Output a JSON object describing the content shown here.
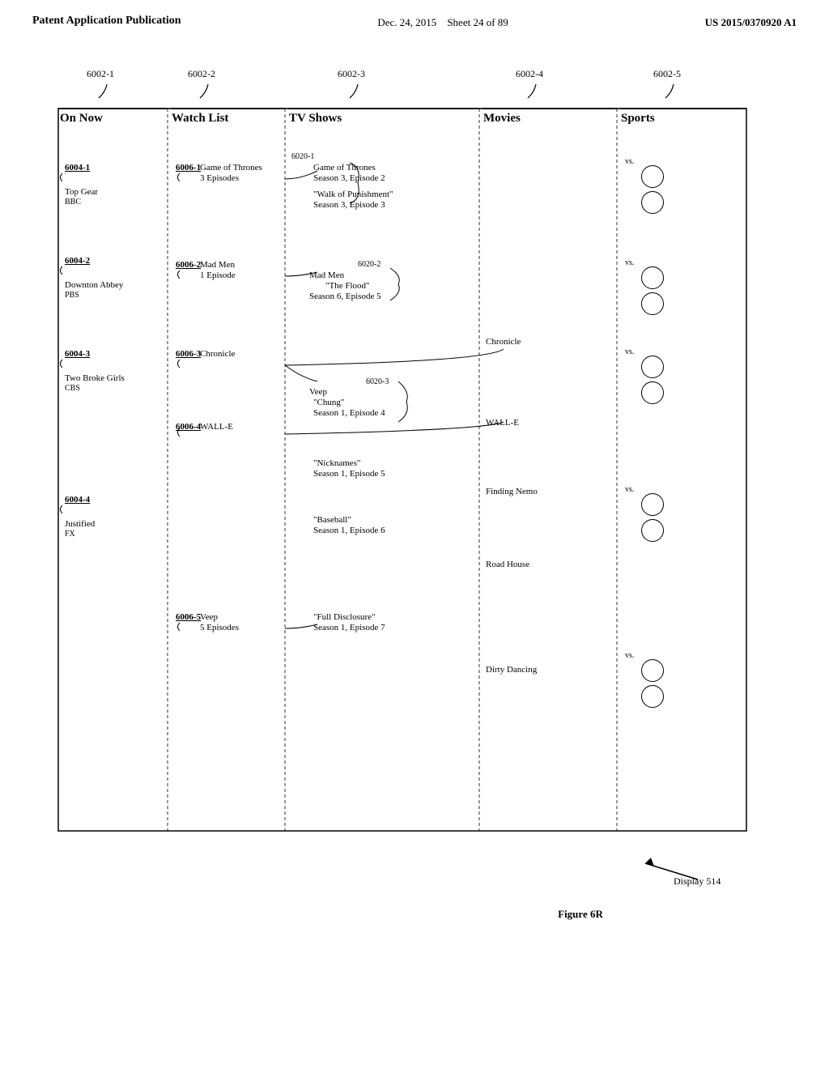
{
  "header": {
    "left": "Patent Application Publication",
    "center": "Dec. 24, 2015",
    "sheet": "Sheet 24 of 89",
    "right": "US 2015/0370920 A1"
  },
  "diagram": {
    "col_labels": [
      {
        "id": "6002-1",
        "text": "6002-1"
      },
      {
        "id": "6002-2",
        "text": "6002-2"
      },
      {
        "id": "6002-3",
        "text": "6002-3"
      },
      {
        "id": "6002-4",
        "text": "6002-4"
      },
      {
        "id": "6002-5",
        "text": "6002-5"
      }
    ],
    "section_headers": [
      {
        "id": "on-now",
        "text": "On Now"
      },
      {
        "id": "watch-list",
        "text": "Watch List"
      },
      {
        "id": "tv-shows",
        "text": "TV Shows"
      },
      {
        "id": "movies",
        "text": "Movies"
      },
      {
        "id": "sports",
        "text": "Sports"
      }
    ],
    "on_now_rows": [
      {
        "id": "6004-1",
        "label": "6004-1",
        "name": "",
        "network": ""
      },
      {
        "id": "6004-1-top",
        "label": "",
        "name": "Top Gear",
        "network": "BBC"
      },
      {
        "id": "6004-2",
        "label": "6004-2",
        "name": "",
        "network": ""
      },
      {
        "id": "6004-2-name",
        "label": "",
        "name": "Downton Abbey",
        "network": "PBS"
      },
      {
        "id": "6004-3",
        "label": "6004-3",
        "name": "",
        "network": ""
      },
      {
        "id": "6004-3-name",
        "label": "",
        "name": "Two Broke Girls",
        "network": "CBS"
      },
      {
        "id": "6004-4",
        "label": "6004-4",
        "name": "",
        "network": ""
      },
      {
        "id": "6004-4-name",
        "label": "",
        "name": "Justified",
        "network": "FX"
      }
    ],
    "watch_list_rows": [
      {
        "id": "6006-1",
        "label": "6006-1",
        "title": "Game of Thrones",
        "episodes": "3 Episodes"
      },
      {
        "id": "6006-2",
        "label": "6006-2",
        "title": "Mad Men",
        "episodes": "1 Episode"
      },
      {
        "id": "6006-3",
        "label": "6006-3",
        "title": "Chronicle",
        "episodes": ""
      },
      {
        "id": "6006-4",
        "label": "6006-4",
        "title": "WALL-E",
        "episodes": ""
      },
      {
        "id": "6006-5",
        "label": "6006-5",
        "title": "Veep",
        "episodes": "5 Episodes"
      }
    ],
    "tv_shows_rows": [
      {
        "group": "6020-1",
        "items": [
          {
            "title": "Game of Thrones",
            "detail": "Season 3, Episode 2"
          },
          {
            "title": "\"Walk of Punishment\"",
            "detail": "Season 3, Episode 3"
          }
        ]
      },
      {
        "group": "6020-2",
        "items": [
          {
            "title": "Mad Men",
            "detail": "\"The Flood\""
          },
          {
            "title": "",
            "detail": "Season 6, Episode 5"
          }
        ]
      },
      {
        "group": "6020-3",
        "items": [
          {
            "title": "Veep",
            "detail": ""
          },
          {
            "title": "\"Chung\"",
            "detail": "Season 1, Episode 4"
          }
        ]
      },
      {
        "group": null,
        "items": [
          {
            "title": "\"Nicknames\"",
            "detail": "Season 1, Episode 5"
          }
        ]
      },
      {
        "group": null,
        "items": [
          {
            "title": "\"Baseball\"",
            "detail": "Season 1, Episode 6"
          }
        ]
      },
      {
        "group": null,
        "items": [
          {
            "title": "\"Full Disclosure\"",
            "detail": "Season 1, Episode 7"
          }
        ]
      }
    ],
    "movies_rows": [
      {
        "title": "Chronicle",
        "extra": ""
      },
      {
        "title": "WALL-E",
        "extra": ""
      },
      {
        "title": "Finding Nemo",
        "extra": ""
      },
      {
        "title": "Road House",
        "extra": ""
      },
      {
        "title": "Dirty Dancing",
        "extra": ""
      }
    ],
    "sports_vs": [
      "vs.",
      "vs.",
      "vs.",
      "vs.",
      "vs."
    ],
    "figure": "Figure 6R",
    "display_label": "Display 514"
  }
}
